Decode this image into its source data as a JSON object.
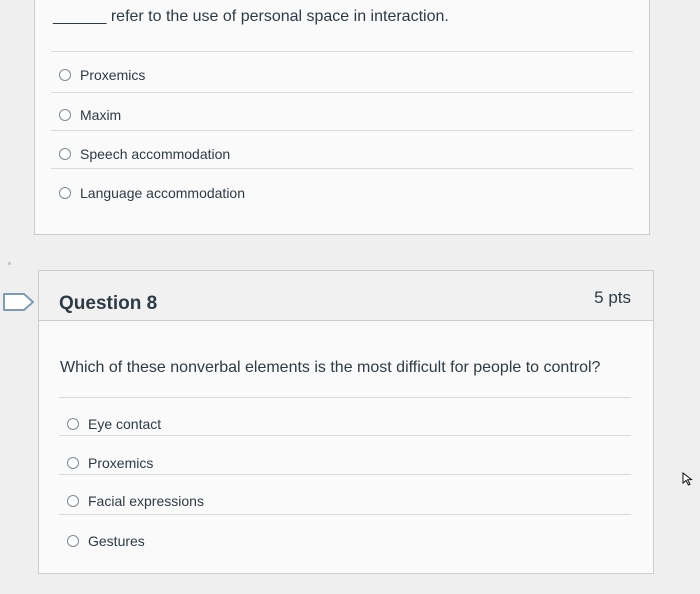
{
  "question7": {
    "prompt": "______ refer to the use of personal space in interaction.",
    "options": [
      "Proxemics",
      "Maxim",
      "Speech accommodation",
      "Language accommodation"
    ]
  },
  "question8": {
    "title": "Question 8",
    "points": "5 pts",
    "prompt": "Which of these nonverbal elements is the most difficult for people to control?",
    "options": [
      "Eye contact",
      "Proxemics",
      "Facial expressions",
      "Gestures"
    ]
  },
  "icons": {
    "bookmark": "bookmark-flag-icon",
    "cursor": "mouse-pointer-icon"
  },
  "colors": {
    "text": "#2d3b45",
    "border": "#c7cdd1",
    "header_bg": "#f1f1f1",
    "bookmark": "#7c9bb8"
  }
}
